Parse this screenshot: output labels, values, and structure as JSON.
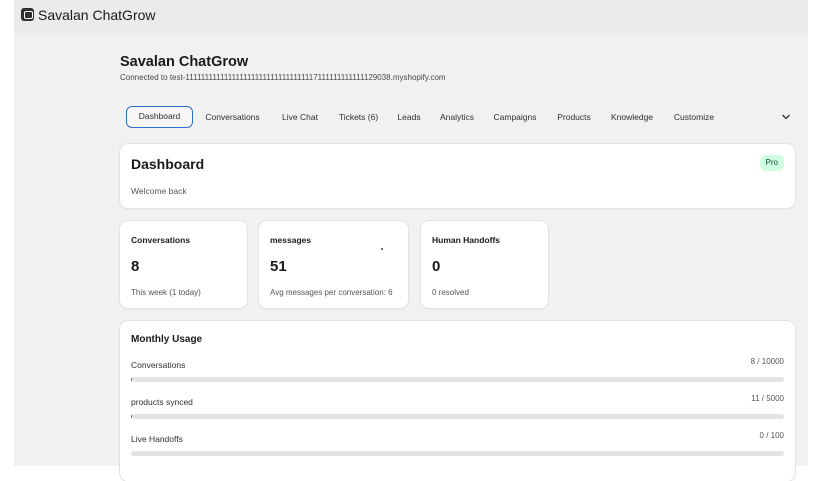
{
  "app": {
    "name": "Savalan ChatGrow"
  },
  "page": {
    "title": "Savalan ChatGrow",
    "subtitle": "Connected to test-1111111111111111111111111111111117111111111111129038.myshopify.com"
  },
  "tabs": [
    {
      "label": "Dashboard",
      "active": true
    },
    {
      "label": "Conversations"
    },
    {
      "label": "Live Chat"
    },
    {
      "label": "Tickets (6)"
    },
    {
      "label": "Leads"
    },
    {
      "label": "Analytics"
    },
    {
      "label": "Campaigns"
    },
    {
      "label": "Products"
    },
    {
      "label": "Knowledge"
    },
    {
      "label": "Customize"
    }
  ],
  "more_icon": "chevron-down-icon",
  "dashboard": {
    "title": "Dashboard",
    "welcome": "Welcome back",
    "plan_badge": "Pro"
  },
  "stats": [
    {
      "label": "Conversations",
      "value": "8",
      "sub": "This week (1 today)"
    },
    {
      "label": "messages",
      "value": "51",
      "sub": "Avg messages per conversation: 6"
    },
    {
      "label": "Human Handoffs",
      "value": "0",
      "sub": "0 resolved"
    }
  ],
  "usage": {
    "title": "Monthly Usage",
    "rows": [
      {
        "label": "Conversations",
        "count": "8 / 10000",
        "used": 8,
        "limit": 10000
      },
      {
        "label": "products synced",
        "count": "11 / 5000",
        "used": 11,
        "limit": 5000
      },
      {
        "label": "Live Handoffs",
        "count": "0 / 100",
        "used": 0,
        "limit": 100
      }
    ]
  },
  "colors": {
    "accent": "#2c6ecb",
    "badge_bg": "#cdfee1",
    "badge_text": "#0c5132"
  }
}
